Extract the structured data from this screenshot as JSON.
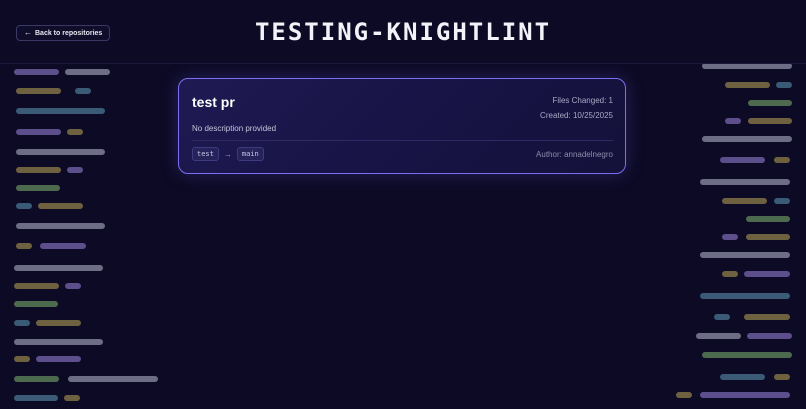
{
  "header": {
    "back_label": "Back to repositories",
    "back_icon": "arrow-left-icon",
    "title": "TESTING-KNIGHTLINT"
  },
  "pull_request": {
    "title": "test pr",
    "files_changed": "Files Changed: 1",
    "created": "Created: 10/25/2025",
    "description": "No description provided",
    "source_branch": "test",
    "target_branch": "main",
    "author": "Author: annadelnegro"
  },
  "colors": {
    "background": "#0c0a24",
    "card_border": "#7b6ff0",
    "code_purple": "#5d4f8c",
    "code_gray": "#6e6d86",
    "code_gold": "#6e6140",
    "code_green": "#4d6a4e",
    "code_teal": "#3a5a76"
  }
}
